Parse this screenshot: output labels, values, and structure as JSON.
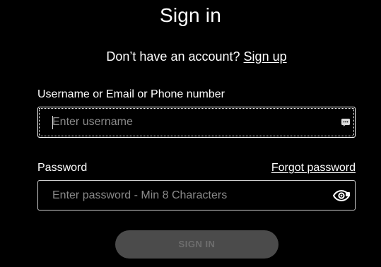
{
  "header": {
    "title": "Sign in"
  },
  "signup": {
    "prompt": "Don’t have an account?",
    "link_label": "Sign up"
  },
  "username": {
    "label": "Username or Email or Phone number",
    "placeholder": "Enter username",
    "value": "",
    "icon": "autofill-icon"
  },
  "password": {
    "label": "Password",
    "placeholder": "Enter password - Min 8 Characters",
    "value": "",
    "forgot_label": "Forgot password",
    "icon": "eye-icon"
  },
  "submit": {
    "label": "SIGN IN",
    "disabled": true
  },
  "colors": {
    "background": "#000000",
    "text": "#ffffff",
    "placeholder": "#8a8a8a",
    "button_bg": "#4b4b4b",
    "button_text": "#6e6e6e"
  }
}
